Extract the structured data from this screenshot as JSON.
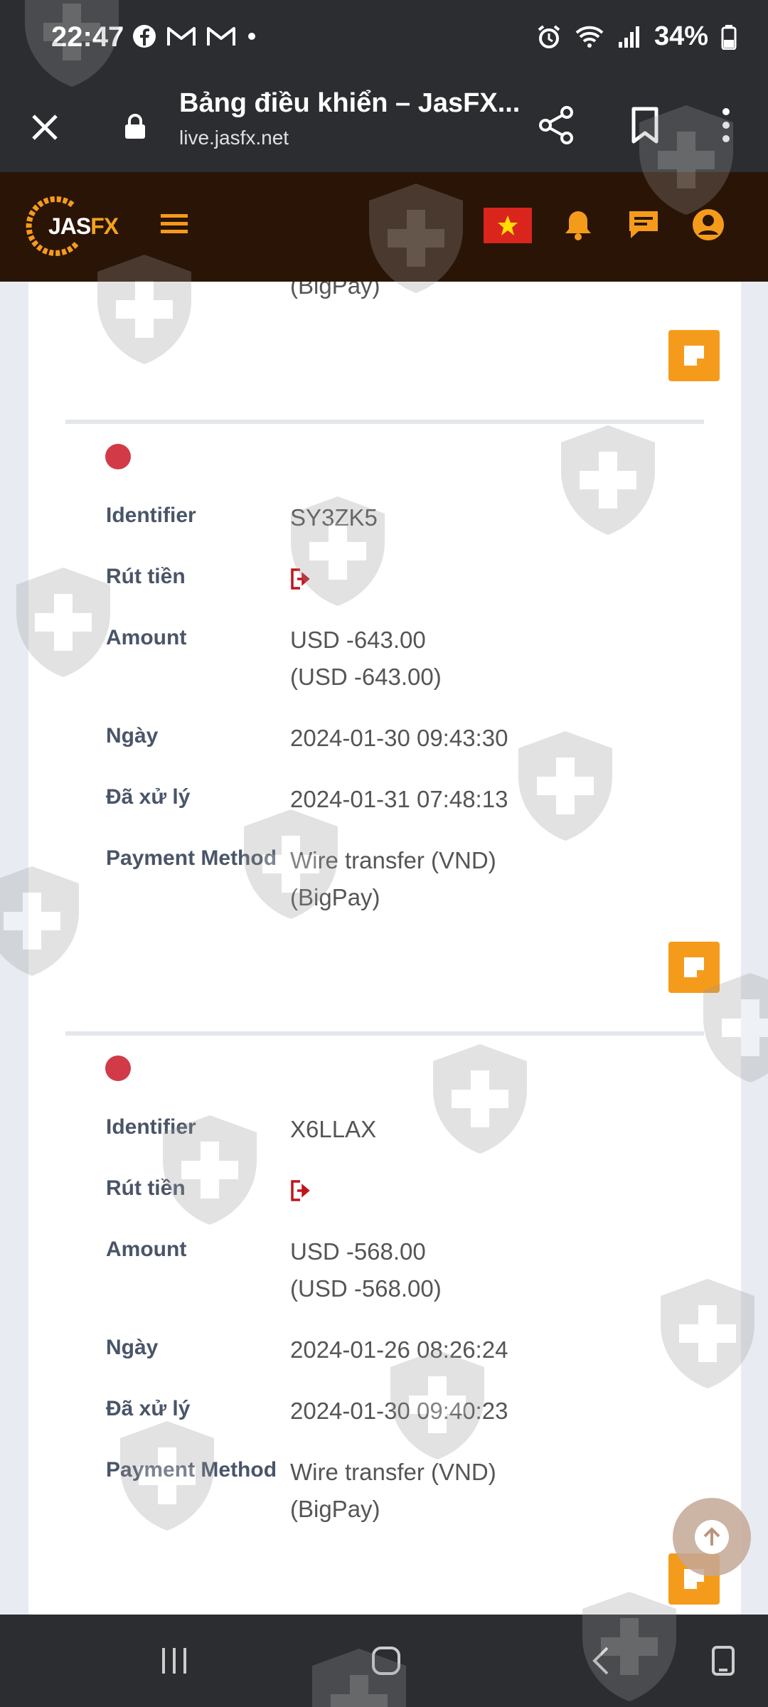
{
  "status_bar": {
    "time": "22:47",
    "battery": "34%",
    "icons": [
      "facebook-icon",
      "gmail-icon",
      "gmail-icon",
      "dot-icon",
      "alarm-icon",
      "wifi-icon",
      "signal-icon",
      "battery-icon"
    ]
  },
  "browser": {
    "title": "Bảng điều khiển – JasFX...",
    "url": "live.jasfx.net"
  },
  "site": {
    "logo_a": "JAS",
    "logo_b": "FX",
    "accent": "#f59b1b",
    "header_bg": "#2a1406"
  },
  "partial_top": {
    "payment_method_tail": "(BigPay)"
  },
  "labels": {
    "identifier": "Identifier",
    "type": "Rút tiền",
    "amount": "Amount",
    "date": "Ngày",
    "processed": "Đã xử lý",
    "payment_method": "Payment Method"
  },
  "transactions": [
    {
      "identifier": "SY3ZK5",
      "amount": "USD -643.00",
      "amount_converted": "(USD -643.00)",
      "date": "2024-01-30 09:43:30",
      "processed": "2024-01-31 07:48:13",
      "payment_method": "Wire transfer (VND)",
      "payment_method_sub": "(BigPay)"
    },
    {
      "identifier": "X6LLAX",
      "amount": "USD -568.00",
      "amount_converted": "(USD -568.00)",
      "date": "2024-01-26 08:26:24",
      "processed": "2024-01-30 09:40:23",
      "payment_method": "Wire transfer (VND)",
      "payment_method_sub": "(BigPay)"
    }
  ],
  "colors": {
    "status_dot": "#d23a48",
    "edit_button": "#f59b1b",
    "withdraw_icon": "#c0141c"
  }
}
